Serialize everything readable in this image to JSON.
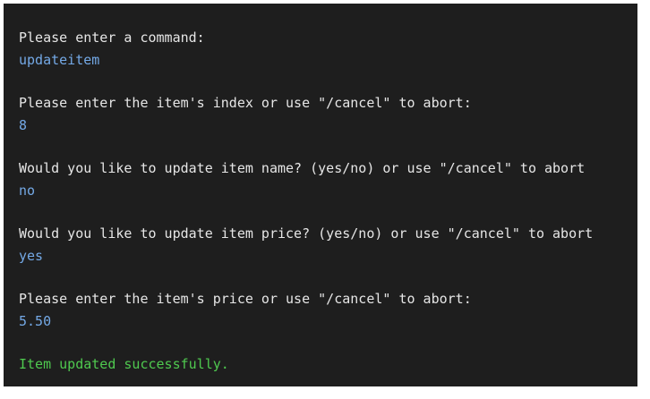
{
  "terminal": {
    "colors": {
      "background": "#1e1e1e",
      "prompt_text": "#e6e6e6",
      "user_input": "#74a9e6",
      "success": "#4fc94f"
    },
    "exchanges": [
      {
        "prompt": "Please enter a command:",
        "input": "updateitem"
      },
      {
        "prompt": "Please enter the item's index or use \"/cancel\" to abort:",
        "input": "8"
      },
      {
        "prompt": "Would you like to update item name? (yes/no) or use \"/cancel\" to abort",
        "input": "no"
      },
      {
        "prompt": "Would you like to update item price? (yes/no) or use \"/cancel\" to abort",
        "input": "yes"
      },
      {
        "prompt": "Please enter the item's price or use \"/cancel\" to abort:",
        "input": "5.50"
      }
    ],
    "result": "Item updated successfully."
  }
}
